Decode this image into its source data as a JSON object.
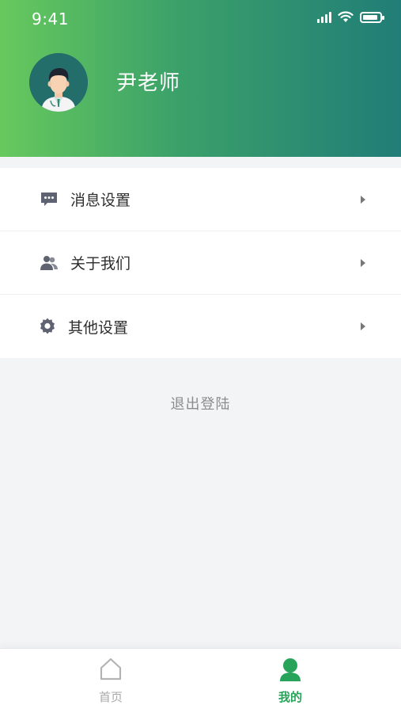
{
  "status_bar": {
    "time": "9:41"
  },
  "profile": {
    "name": "尹老师"
  },
  "menu": {
    "items": [
      {
        "label": "消息设置",
        "icon": "message-icon"
      },
      {
        "label": "关于我们",
        "icon": "users-icon"
      },
      {
        "label": "其他设置",
        "icon": "gear-icon"
      }
    ]
  },
  "logout": {
    "label": "退出登陆"
  },
  "tabbar": {
    "tabs": [
      {
        "label": "首页",
        "icon": "home-icon",
        "active": false
      },
      {
        "label": "我的",
        "icon": "person-icon",
        "active": true
      }
    ]
  },
  "colors": {
    "gradient_start": "#67c95d",
    "gradient_end": "#217d77",
    "accent": "#27a35a",
    "page_bg": "#f3f4f6"
  }
}
